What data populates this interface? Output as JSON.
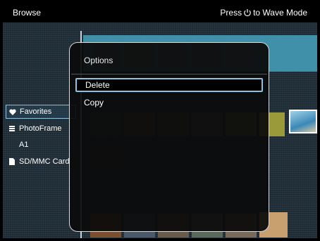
{
  "topbar": {
    "title": "Browse",
    "hint_prefix": "Press",
    "hint_suffix": "to Wave Mode",
    "hint_icon": "power-icon"
  },
  "sidebar": {
    "items": [
      {
        "label": "Favorites",
        "icon": "heart-icon",
        "selected": true
      },
      {
        "label": "PhotoFrame",
        "icon": "list-icon",
        "selected": false
      },
      {
        "label": "A1",
        "icon": "",
        "selected": false
      },
      {
        "label": "SD/MMC Card",
        "icon": "memory-card-icon",
        "selected": false
      }
    ]
  },
  "dialog": {
    "title": "Options",
    "options": [
      {
        "label": "Delete",
        "selected": true
      },
      {
        "label": "Copy",
        "selected": false
      }
    ]
  },
  "colors": {
    "accent": "#8fc2de",
    "band": "#3f90a8",
    "background": "#1c2a34"
  }
}
